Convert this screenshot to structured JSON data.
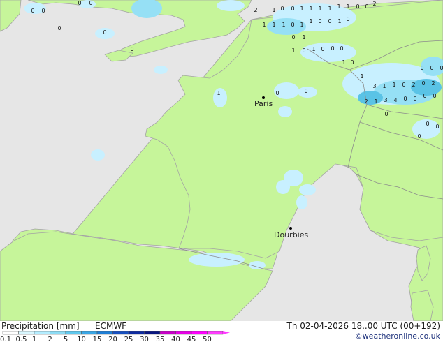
{
  "colors": {
    "sea": "#e6e6e6",
    "land": "#c6f59a",
    "coast": "#a3a3a3",
    "border": "#8c8c8c",
    "precip_light": "#c8f0ff",
    "precip_mid": "#96e0f5",
    "precip_strong": "#5ac3e6",
    "city_dot": "#000000"
  },
  "map": {
    "cities": [
      {
        "name": "Paris"
      },
      {
        "name": "Dourbies"
      }
    ],
    "precip_labels": [
      "0",
      "0",
      "0",
      "0",
      "0",
      "0",
      "0",
      "2",
      "1",
      "0",
      "0",
      "1",
      "1",
      "1",
      "1",
      "1",
      "1",
      "0",
      "0",
      "2",
      "1",
      "1",
      "1",
      "0",
      "1",
      "1",
      "0",
      "0",
      "1",
      "0",
      "0",
      "1",
      "1",
      "0",
      "1",
      "0",
      "0",
      "0",
      "1",
      "0",
      "1",
      "3",
      "1",
      "1",
      "0",
      "2",
      "0",
      "2",
      "2",
      "1",
      "3",
      "4",
      "0",
      "0",
      "0",
      "0",
      "0",
      "0",
      "0",
      "0",
      "0",
      "0",
      "0",
      "1",
      "0",
      "0"
    ]
  },
  "footer": {
    "title": "Precipitation [mm]",
    "model": "ECMWF",
    "valid": "Th 02-04-2026 18..00 UTC (00+192)",
    "credit": "©weatheronline.co.uk"
  },
  "legend": {
    "labels": [
      "0.1",
      "0.5",
      "1",
      "2",
      "5",
      "10",
      "15",
      "20",
      "25",
      "30",
      "35",
      "40",
      "45",
      "50"
    ],
    "colors": [
      "#ffffff",
      "#d9f7ff",
      "#b4edff",
      "#8cdcf5",
      "#5fc8ee",
      "#3aa7e6",
      "#1e7fd6",
      "#1850c0",
      "#0f2ca0",
      "#0a1680",
      "#c800c8",
      "#e600e6",
      "#ff00ff",
      "#ff3cff"
    ]
  }
}
